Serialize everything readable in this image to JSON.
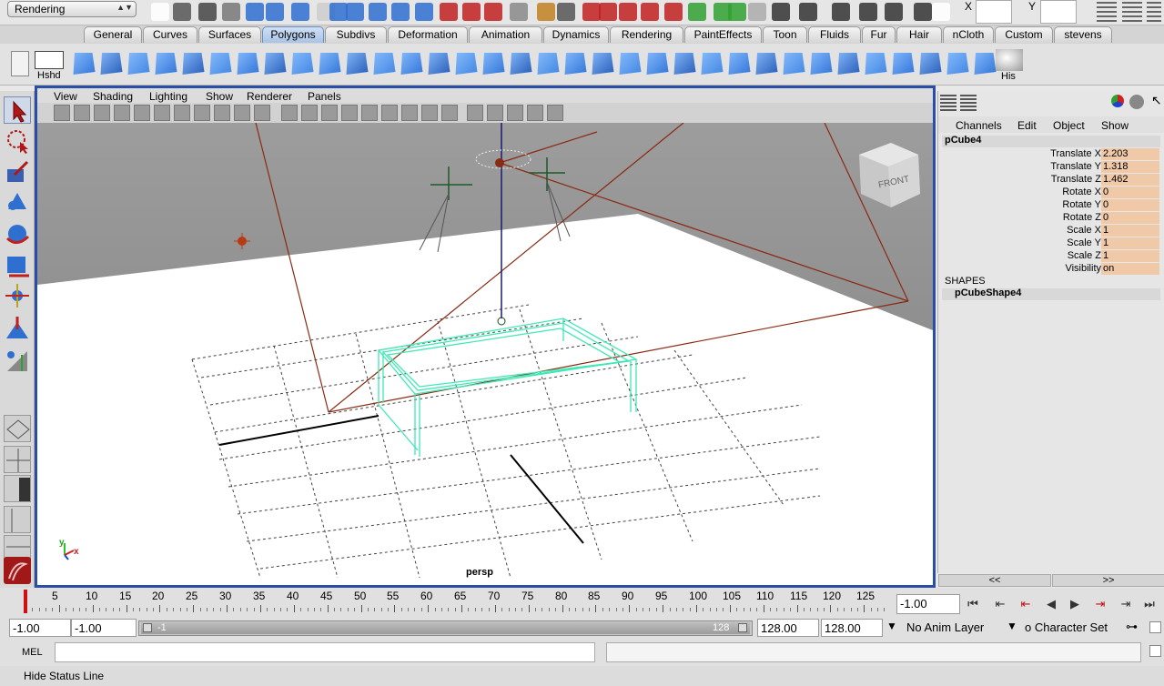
{
  "status": {
    "menu_set": "Rendering",
    "x_label": "X",
    "y_label": "Y"
  },
  "shelf_tabs": [
    "General",
    "Curves",
    "Surfaces",
    "Polygons",
    "Subdivs",
    "Deformation",
    "Animation",
    "Dynamics",
    "Rendering",
    "PaintEffects",
    "Toon",
    "Fluids",
    "Fur",
    "Hair",
    "nCloth",
    "Custom",
    "stevens"
  ],
  "shelf": {
    "first_label": "Hshd",
    "last_label": "His"
  },
  "panel_menu": [
    "View",
    "Shading",
    "Lighting",
    "Show",
    "Renderer",
    "Panels"
  ],
  "viewport": {
    "camera_label": "persp",
    "viewcube_label": "FRONT",
    "axis_x": "x",
    "axis_y": "y"
  },
  "channel_box": {
    "menu": [
      "Channels",
      "Edit",
      "Object",
      "Show"
    ],
    "object_name": "pCube4",
    "attributes": [
      {
        "label": "Translate X",
        "value": "2.203"
      },
      {
        "label": "Translate Y",
        "value": "1.318"
      },
      {
        "label": "Translate Z",
        "value": "1.462"
      },
      {
        "label": "Rotate X",
        "value": "0"
      },
      {
        "label": "Rotate Y",
        "value": "0"
      },
      {
        "label": "Rotate Z",
        "value": "0"
      },
      {
        "label": "Scale X",
        "value": "1"
      },
      {
        "label": "Scale Y",
        "value": "1"
      },
      {
        "label": "Scale Z",
        "value": "1"
      },
      {
        "label": "Visibility",
        "value": "on"
      }
    ],
    "shapes_header": "SHAPES",
    "shape_name": "pCubeShape4",
    "nav_left": "<<",
    "nav_right": ">>"
  },
  "timeline": {
    "ticks": [
      "5",
      "10",
      "15",
      "20",
      "25",
      "30",
      "35",
      "40",
      "45",
      "50",
      "55",
      "60",
      "65",
      "70",
      "75",
      "80",
      "85",
      "90",
      "95",
      "100",
      "105",
      "110",
      "115",
      "120",
      "125"
    ],
    "current_frame": "-1.00"
  },
  "range": {
    "start": "-1.00",
    "playback_start": "-1.00",
    "slider_start": "-1",
    "slider_end": "128",
    "playback_end": "128.00",
    "end": "128.00",
    "anim_layer": "No Anim Layer",
    "character_set": "o Character Set"
  },
  "mel": {
    "label": "MEL"
  },
  "help": {
    "text": "Hide Status Line"
  },
  "colors": {
    "selection_wire": "#3fe8b4",
    "camera_lines": "#8a2a12",
    "channel_value_bg": "#f0c9a8",
    "active_panel_border": "#2a4ea6"
  }
}
